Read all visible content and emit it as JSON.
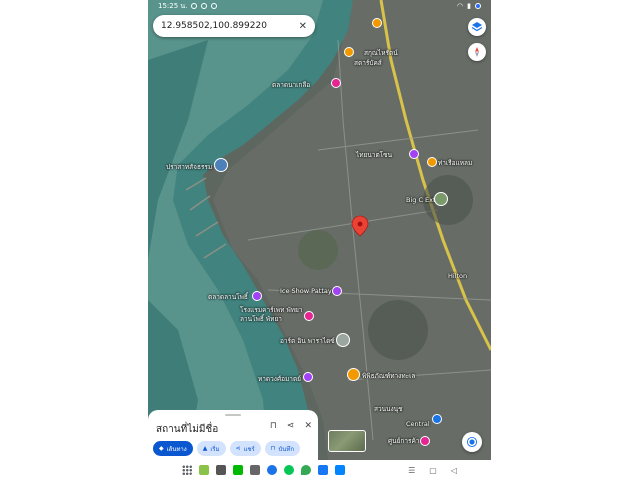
{
  "status_bar": {
    "time": "15:25 น.",
    "status_colors": [
      "#ffffff",
      "#2b6bf5"
    ]
  },
  "search": {
    "value": "12.958502,100.899220",
    "close_icon": "close-icon"
  },
  "top_buttons": [
    {
      "icon": "layers-icon",
      "color": "#1a73e8"
    },
    {
      "icon": "compass-icon",
      "color": "#ea4335"
    }
  ],
  "map": {
    "sea_color": "#41837e",
    "shallow_color": "#6fa49a",
    "land_color": "#5e6660",
    "road_color": "#d8c24a",
    "pin_color": "#ea4335",
    "labels": [
      {
        "text": "สกุณไหรัตน์",
        "icon": "store-icon"
      },
      {
        "text": "สตาร์บัคส์",
        "icon": "cafe-icon"
      },
      {
        "text": "ตลาดนาเกลือ",
        "icon": "shopping-icon"
      },
      {
        "text": "ไทยนาตโซน",
        "icon": "shop-icon"
      },
      {
        "text": "ท่าเรือแหลม",
        "icon": "shop-icon"
      },
      {
        "text": "ปราสาทสัจธรรม",
        "icon": "temple-icon"
      },
      {
        "text": "Big C Extra",
        "icon": "store-icon"
      },
      {
        "text": "อาร์ต อิน พาราไดซ์",
        "icon": "museum-icon"
      },
      {
        "text": "ตลาดลานโพธิ์",
        "icon": "shopping-icon"
      },
      {
        "text": "Ice Show Pattaya",
        "icon": "attraction-icon"
      },
      {
        "text": "โรงแรมคาร์เพท พัทยา",
        "icon": "hotel-icon"
      },
      {
        "text": "สวนนงนุช",
        "icon": "garden-icon"
      },
      {
        "text": "ลานโพธิ์ พัทยา",
        "icon": "attraction-icon"
      },
      {
        "text": "พิพิธภัณฑ์ทางทะเล",
        "icon": "museum-icon"
      },
      {
        "text": "หาดวงศ์อมาตย์",
        "icon": "beach-icon"
      },
      {
        "text": "Central",
        "icon": "store-icon"
      },
      {
        "text": "ศูนย์การค้า",
        "icon": "shopping-icon"
      },
      {
        "text": "Hilton",
        "icon": "hotel-icon"
      }
    ]
  },
  "place_sheet": {
    "title": "สถานที่ไม่มีชื่อ",
    "bookmark_icon": "bookmark-icon",
    "share_icon": "share-icon",
    "close_icon": "close-icon",
    "actions": [
      {
        "label": "เส้นทาง",
        "icon": "directions-icon",
        "primary": true
      },
      {
        "label": "เริ่ม",
        "icon": "navigation-icon",
        "primary": false
      },
      {
        "label": "แชร์",
        "icon": "share-icon",
        "primary": false
      },
      {
        "label": "บันทึก",
        "icon": "bookmark-icon",
        "primary": false
      }
    ]
  },
  "taskbar": {
    "apps": [
      {
        "icon": "app-grid-icon",
        "color": "#5f6368"
      },
      {
        "icon": "files-icon",
        "color": "#8bc34a"
      },
      {
        "icon": "camera-icon",
        "color": "#555555"
      },
      {
        "icon": "chat-icon",
        "color": "#00b900"
      },
      {
        "icon": "settings-icon",
        "color": "#666666"
      },
      {
        "icon": "browser-icon",
        "color": "#1a73e8"
      },
      {
        "icon": "line-icon",
        "color": "#06c755"
      },
      {
        "icon": "maps-icon",
        "color": "#34a853"
      },
      {
        "icon": "facebook-icon",
        "color": "#1877f2"
      },
      {
        "icon": "messenger-icon",
        "color": "#0084ff"
      }
    ],
    "nav": [
      {
        "icon": "recents-icon",
        "glyph": "☰"
      },
      {
        "icon": "home-icon",
        "glyph": "▢"
      },
      {
        "icon": "back-icon",
        "glyph": "◁"
      }
    ]
  }
}
